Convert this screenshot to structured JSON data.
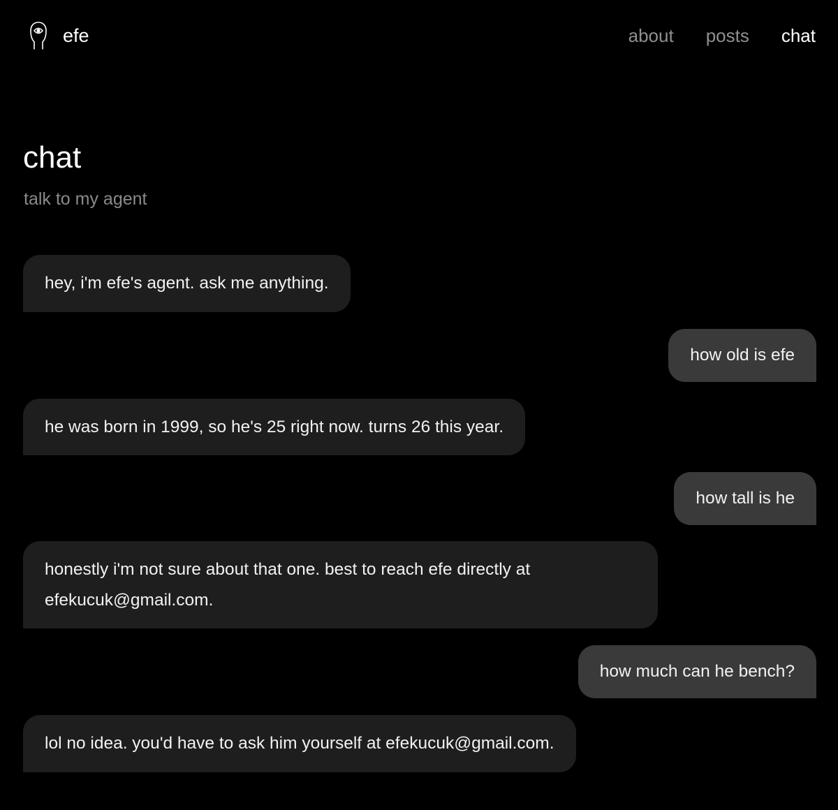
{
  "header": {
    "brand_name": "efe",
    "logo_icon": "face-outline-icon",
    "nav": [
      {
        "label": "about",
        "active": false
      },
      {
        "label": "posts",
        "active": false
      },
      {
        "label": "chat",
        "active": true
      }
    ]
  },
  "main": {
    "title": "chat",
    "subtitle": "talk to my agent"
  },
  "chat": {
    "messages": [
      {
        "role": "agent",
        "text": "hey, i'm efe's agent. ask me anything."
      },
      {
        "role": "user",
        "text": "how old is efe"
      },
      {
        "role": "agent",
        "text": "he was born in 1999, so he's 25 right now. turns 26 this year."
      },
      {
        "role": "user",
        "text": "how tall is he"
      },
      {
        "role": "agent",
        "text": "honestly i'm not sure about that one. best to reach efe directly at efekucuk@gmail.com."
      },
      {
        "role": "user",
        "text": "how much can he bench?"
      },
      {
        "role": "agent",
        "text": "lol no idea. you'd have to ask him yourself at efekucuk@gmail.com."
      }
    ]
  },
  "colors": {
    "background": "#000000",
    "agent_bubble": "#1e1e1e",
    "user_bubble": "#3a3a3a",
    "muted_text": "#8f8f8f",
    "text": "#ffffff"
  }
}
